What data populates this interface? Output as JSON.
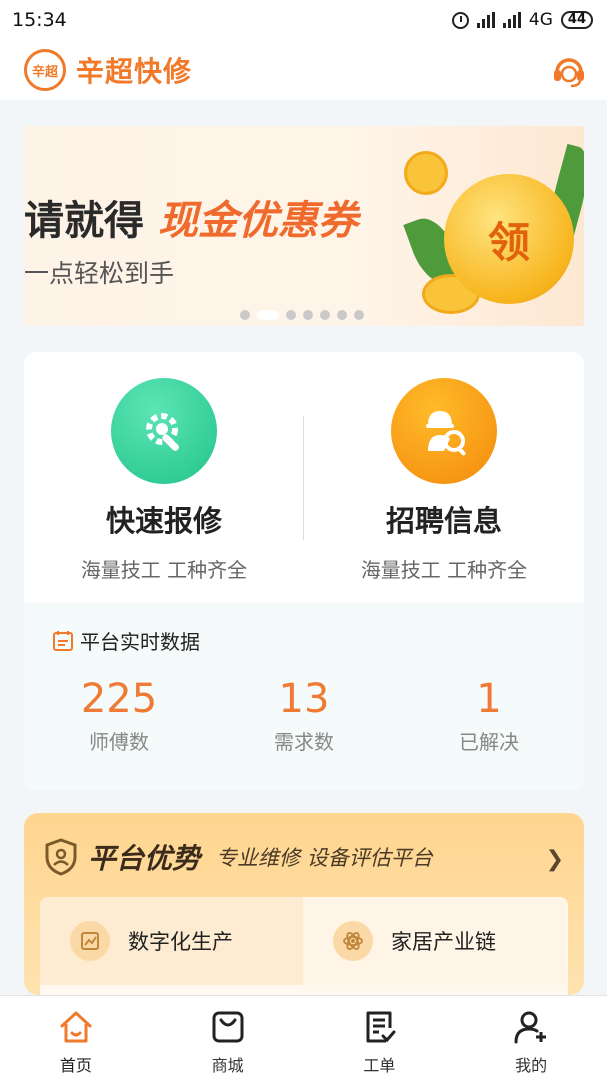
{
  "status_bar": {
    "time": "15:34",
    "network": "4G",
    "battery": "44"
  },
  "header": {
    "logo_text": "辛超",
    "app_name": "辛超快修",
    "service_icon": "customer-service-headset-icon"
  },
  "banner": {
    "title_prefix": "请就得",
    "title_highlight": "现金优惠券",
    "subtitle": "一点轻松到手",
    "coin_text": "领",
    "dots_count": 7,
    "active_dot": 1
  },
  "quick_actions": [
    {
      "title": "快速报修",
      "subtitle": "海量技工 工种齐全",
      "icon": "gear-wrench-icon",
      "color": "#22c48a"
    },
    {
      "title": "招聘信息",
      "subtitle": "海量技工 工种齐全",
      "icon": "worker-search-icon",
      "color": "#f48a0c"
    }
  ],
  "stats": {
    "heading": "平台实时数据",
    "items": [
      {
        "value": "225",
        "label": "师傅数"
      },
      {
        "value": "13",
        "label": "需求数"
      },
      {
        "value": "1",
        "label": "已解决"
      }
    ]
  },
  "advantage": {
    "title": "平台优势",
    "subtitle": "专业维修 设备评估平台",
    "items": [
      {
        "label": "数字化生产",
        "icon": "chart-icon"
      },
      {
        "label": "家居产业链",
        "icon": "atom-icon"
      }
    ]
  },
  "tabs": [
    {
      "label": "首页",
      "icon": "home-icon",
      "active": true
    },
    {
      "label": "商城",
      "icon": "shopping-bag-icon",
      "active": false
    },
    {
      "label": "工单",
      "icon": "work-order-icon",
      "active": false
    },
    {
      "label": "我的",
      "icon": "user-add-icon",
      "active": false
    }
  ],
  "colors": {
    "brand": "#f07a2a",
    "stat_value": "#ef7a35",
    "green": "#22c48a",
    "orange": "#f48a0c"
  }
}
